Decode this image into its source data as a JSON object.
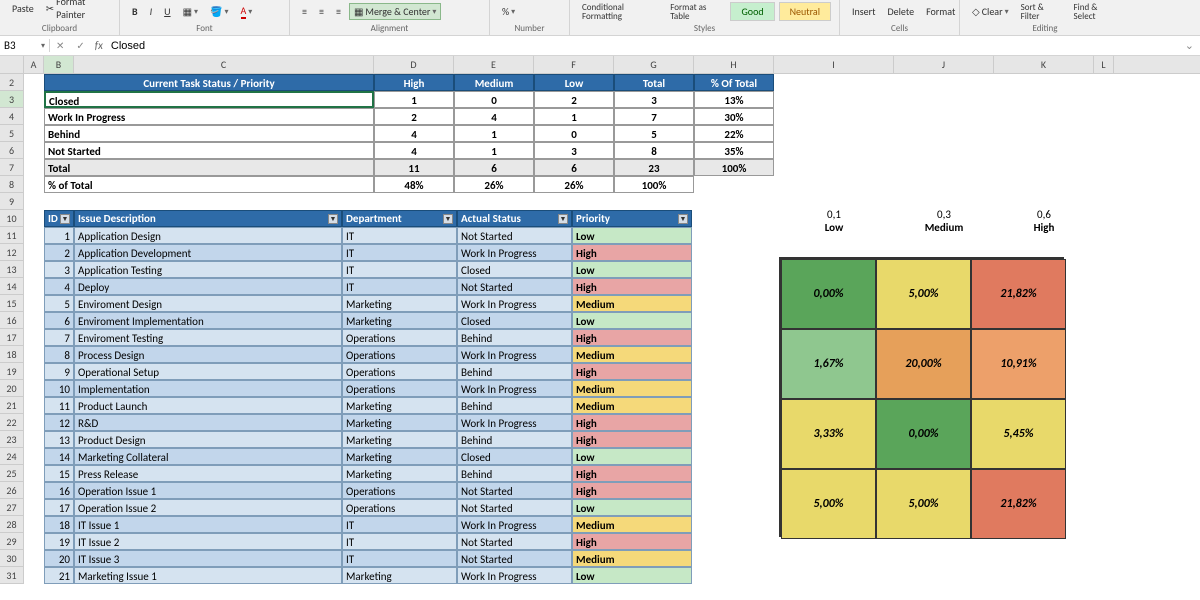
{
  "ribbon": {
    "paste": "Paste",
    "format_painter": "Format Painter",
    "clipboard": "Clipboard",
    "font": "Font",
    "alignment": "Alignment",
    "merge_center": "Merge & Center",
    "number": "Number",
    "conditional_formatting": "Conditional\nFormatting",
    "format_as_table": "Format as\nTable",
    "good": "Good",
    "neutral": "Neutral",
    "styles": "Styles",
    "insert": "Insert",
    "delete": "Delete",
    "format": "Format",
    "cells": "Cells",
    "clear": "Clear",
    "sort_filter": "Sort &\nFilter",
    "find_select": "Find &\nSelect",
    "editing": "Editing"
  },
  "namebox": "B3",
  "formula": "Closed",
  "columns": [
    "A",
    "B",
    "C",
    "D",
    "E",
    "F",
    "G",
    "H",
    "I",
    "J",
    "K",
    "L"
  ],
  "col_widths": {
    "A": 20,
    "B": 30,
    "C": 300,
    "D": 80,
    "E": 80,
    "F": 80,
    "G": 80,
    "H": 80,
    "I": 120,
    "J": 100,
    "K": 100,
    "L": 20
  },
  "rows_start": 2,
  "rows_end": 31,
  "summary": {
    "title": "Current Task Status / Priority",
    "cols": [
      "High",
      "Medium",
      "Low",
      "Total",
      "% Of Total"
    ],
    "rows": [
      {
        "label": "Closed",
        "vals": [
          "1",
          "0",
          "2",
          "3",
          "13%"
        ]
      },
      {
        "label": "Work In Progress",
        "vals": [
          "2",
          "4",
          "1",
          "7",
          "30%"
        ]
      },
      {
        "label": "Behind",
        "vals": [
          "4",
          "1",
          "0",
          "5",
          "22%"
        ]
      },
      {
        "label": "Not Started",
        "vals": [
          "4",
          "1",
          "3",
          "8",
          "35%"
        ]
      }
    ],
    "total": {
      "label": "Total",
      "vals": [
        "11",
        "6",
        "6",
        "23",
        "100%"
      ]
    },
    "pct": {
      "label": "% of Total",
      "vals": [
        "48%",
        "26%",
        "26%",
        "100%",
        ""
      ]
    }
  },
  "issues": {
    "headers": [
      "ID",
      "Issue Description",
      "Department",
      "Actual Status",
      "Priority"
    ],
    "rows": [
      {
        "id": "1",
        "desc": "Application Design",
        "dept": "IT",
        "status": "Not Started",
        "pri": "Low"
      },
      {
        "id": "2",
        "desc": "Application Development",
        "dept": "IT",
        "status": "Work In Progress",
        "pri": "High"
      },
      {
        "id": "3",
        "desc": "Application Testing",
        "dept": "IT",
        "status": "Closed",
        "pri": "Low"
      },
      {
        "id": "4",
        "desc": "Deploy",
        "dept": "IT",
        "status": "Not Started",
        "pri": "High"
      },
      {
        "id": "5",
        "desc": "Enviroment Design",
        "dept": "Marketing",
        "status": "Work In Progress",
        "pri": "Medium"
      },
      {
        "id": "6",
        "desc": "Enviroment Implementation",
        "dept": "Marketing",
        "status": "Closed",
        "pri": "Low"
      },
      {
        "id": "7",
        "desc": "Enviroment Testing",
        "dept": "Operations",
        "status": "Behind",
        "pri": "High"
      },
      {
        "id": "8",
        "desc": "Process Design",
        "dept": "Operations",
        "status": "Work In Progress",
        "pri": "Medium"
      },
      {
        "id": "9",
        "desc": "Operational Setup",
        "dept": "Operations",
        "status": "Behind",
        "pri": "High"
      },
      {
        "id": "10",
        "desc": "Implementation",
        "dept": "Operations",
        "status": "Work In Progress",
        "pri": "Medium"
      },
      {
        "id": "11",
        "desc": "Product Launch",
        "dept": "Marketing",
        "status": "Behind",
        "pri": "Medium"
      },
      {
        "id": "12",
        "desc": "R&D",
        "dept": "Marketing",
        "status": "Work In Progress",
        "pri": "High"
      },
      {
        "id": "13",
        "desc": "Product Design",
        "dept": "Marketing",
        "status": "Behind",
        "pri": "High"
      },
      {
        "id": "14",
        "desc": "Marketing Collateral",
        "dept": "Marketing",
        "status": "Closed",
        "pri": "Low"
      },
      {
        "id": "15",
        "desc": "Press Release",
        "dept": "Marketing",
        "status": "Behind",
        "pri": "High"
      },
      {
        "id": "16",
        "desc": "Operation Issue 1",
        "dept": "Operations",
        "status": "Not Started",
        "pri": "High"
      },
      {
        "id": "17",
        "desc": "Operation Issue 2",
        "dept": "Operations",
        "status": "Not Started",
        "pri": "Low"
      },
      {
        "id": "18",
        "desc": "IT Issue 1",
        "dept": "IT",
        "status": "Work In Progress",
        "pri": "Medium"
      },
      {
        "id": "19",
        "desc": "IT Issue 2",
        "dept": "IT",
        "status": "Not Started",
        "pri": "High"
      },
      {
        "id": "20",
        "desc": "IT Issue 3",
        "dept": "IT",
        "status": "Not Started",
        "pri": "Medium"
      },
      {
        "id": "21",
        "desc": "Marketing Issue 1",
        "dept": "Marketing",
        "status": "Work In Progress",
        "pri": "Low"
      }
    ]
  },
  "heatmap": {
    "col_labels": [
      {
        "v": "0,1",
        "t": "Low"
      },
      {
        "v": "0,3",
        "t": "Medium"
      },
      {
        "v": "0,6",
        "t": "High"
      }
    ],
    "cells": [
      [
        {
          "v": "0,00%",
          "c": "#5aa55a"
        },
        {
          "v": "5,00%",
          "c": "#e8d96a"
        },
        {
          "v": "21,82%",
          "c": "#e07a5f"
        }
      ],
      [
        {
          "v": "1,67%",
          "c": "#8fc78f"
        },
        {
          "v": "20,00%",
          "c": "#e6a05a"
        },
        {
          "v": "10,91%",
          "c": "#eda06a"
        }
      ],
      [
        {
          "v": "3,33%",
          "c": "#e8d96a"
        },
        {
          "v": "0,00%",
          "c": "#5aa55a"
        },
        {
          "v": "5,45%",
          "c": "#e8d96a"
        }
      ],
      [
        {
          "v": "5,00%",
          "c": "#e8d96a"
        },
        {
          "v": "5,00%",
          "c": "#e8d96a"
        },
        {
          "v": "21,82%",
          "c": "#e07a5f"
        }
      ]
    ]
  }
}
